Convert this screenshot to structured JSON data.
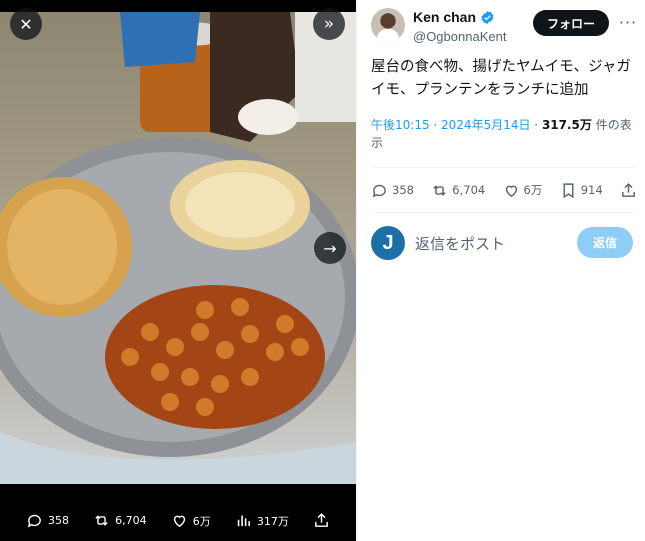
{
  "media": {
    "close_icon": "close-icon",
    "expand_icon": "chevron-double-right-icon",
    "next_icon": "arrow-right-icon",
    "actions": {
      "replies": "358",
      "retweets": "6,704",
      "likes": "6万",
      "views": "317万"
    }
  },
  "tweet": {
    "display_name": "Ken chan",
    "handle": "@OgbonnaKent",
    "follow_label": "フォロー",
    "more_label": "···",
    "text": "屋台の食べ物、揚げたヤムイモ、ジャガイモ、プランテンをランチに追加",
    "time": "午後10:15 · 2024年5月14日",
    "separator": " · ",
    "views_count": "317.5万",
    "views_suffix": " 件の表示",
    "counts": {
      "replies": "358",
      "retweets": "6,704",
      "likes": "6万",
      "bookmarks": "914"
    },
    "reply_avatar_letter": "J",
    "reply_placeholder": "返信をポスト",
    "reply_button": "返信"
  },
  "colors": {
    "accent": "#1d9bf0",
    "text": "#0f1419",
    "muted": "#536471",
    "reply_button_disabled": "#8ecdf8"
  }
}
